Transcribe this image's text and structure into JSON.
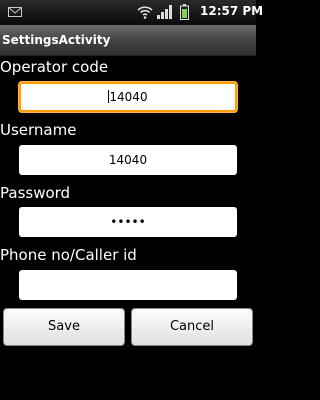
{
  "status_bar": {
    "time": "12:57 PM",
    "icons": [
      "mail-icon",
      "wifi-icon",
      "signal-icon",
      "battery-icon"
    ]
  },
  "title_bar": {
    "title": "SettingsActivity"
  },
  "form": {
    "operator_code": {
      "label": "Operator code",
      "value": "14040"
    },
    "username": {
      "label": "Username",
      "value": "14040"
    },
    "password": {
      "label": "Password",
      "value": "•••••"
    },
    "phone": {
      "label": "Phone no/Caller id",
      "value": ""
    }
  },
  "buttons": {
    "save": "Save",
    "cancel": "Cancel"
  },
  "colors": {
    "focus": "#ff9c00",
    "background": "#000000"
  }
}
